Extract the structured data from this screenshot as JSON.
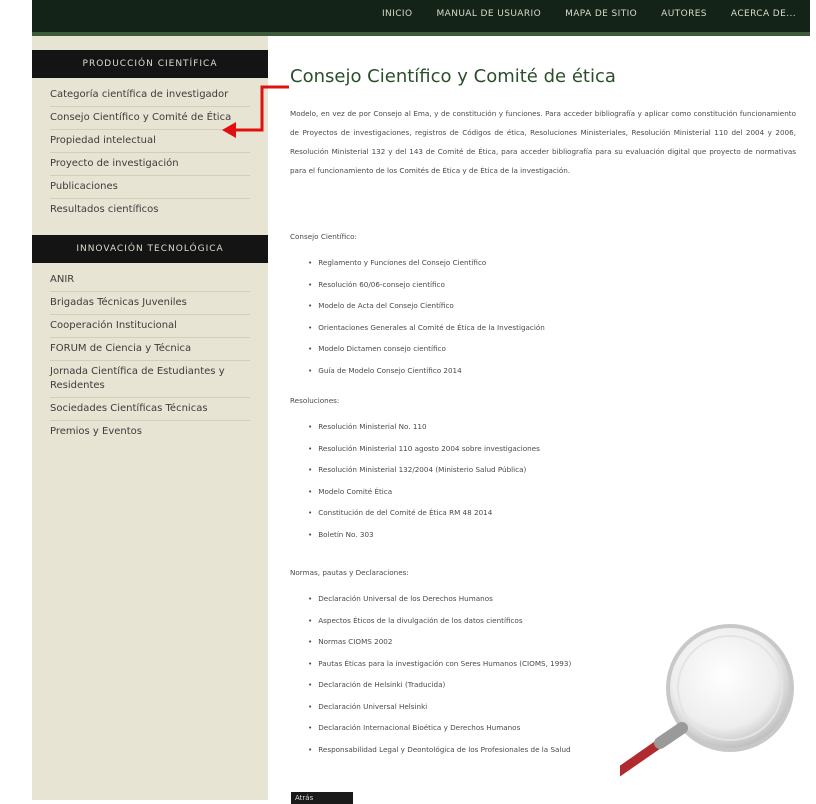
{
  "topnav": [
    "INICIO",
    "MANUAL DE USUARIO",
    "MAPA DE SITIO",
    "AUTORES",
    "ACERCA DE..."
  ],
  "sidebar": {
    "section1_title": "PRODUCCIÓN CIENTÍFICA",
    "section1_items": [
      "Categoría científica de investigador",
      "Consejo Científico y Comité de Ética",
      "Propiedad intelectual",
      "Proyecto de investigación",
      "Publicaciones",
      "Resultados científicos"
    ],
    "section2_title": "INNOVACIÓN TECNOLÓGICA",
    "section2_items": [
      "ANIR",
      "Brigadas Técnicas Juveniles",
      "Cooperación Institucional",
      "FORUM de Ciencia y Técnica",
      "Jornada Científica de Estudiantes y Residentes",
      "Sociedades Científicas Técnicas",
      "Premios y Eventos"
    ]
  },
  "main": {
    "title": "Consejo Científico y Comité de ética",
    "intro": "Modelo, en vez de por Consejo al Ema, y de constitución y funciones. Para acceder bibliografía y aplicar como constitución funcionamiento de Proyectos de investigaciones, registros de Códigos de ética, Resoluciones Ministeriales, Resolución Ministerial 110 del 2004 y 2006, Resolución Ministerial 132 y del 143 de Comité de Ética, para acceder bibliografía para su evaluación digital que proyecto de normativas para el funcionamiento de los Comités de Ética y de Ética de la investigación.",
    "sec1_label": "Consejo Científico:",
    "sec1_items": [
      "Reglamento y Funciones del Consejo Científico",
      "Resolución 60/06-consejo científico",
      "Modelo de Acta del Consejo Científico",
      "Orientaciones Generales al Comité de Ética de la Investigación",
      "Modelo Dictamen consejo científico",
      "Guía de Modelo Consejo Científico 2014"
    ],
    "sec2_label": "Resoluciones:",
    "sec2_items": [
      "Resolución Ministerial No. 110",
      "Resolución Ministerial 110 agosto 2004 sobre investigaciones",
      "Resolución Ministerial 132/2004 (Ministerio Salud Pública)",
      "Modelo Comité Ética",
      "Constitución de del Comité de Ética RM 48 2014",
      "Boletín No. 303"
    ],
    "sec3_label": "Normas, pautas y Declaraciones:",
    "sec3_items": [
      "Declaración Universal de los Derechos Humanos",
      "Aspectos Éticos de la divulgación de los datos científicos",
      "Normas CIOMS 2002",
      "Pautas Éticas para la investigación con Seres Humanos (CIOMS, 1993)",
      "Declaración de Helsinki (Traducida)",
      "Declaración Universal Helsinki",
      "Declaración Internacional Bioética y Derechos Humanos",
      "Responsabilidad Legal y Deontológica de los Profesionales de la Salud"
    ],
    "back_label": "Atrás"
  },
  "colors": {
    "topbar": "#142318",
    "sidebar": "#e8e4d4",
    "title": "#2a4e2a",
    "arrow": "#e01010"
  },
  "icons": [
    "right-angle-arrow-icon",
    "magnifier-decoration-icon"
  ]
}
